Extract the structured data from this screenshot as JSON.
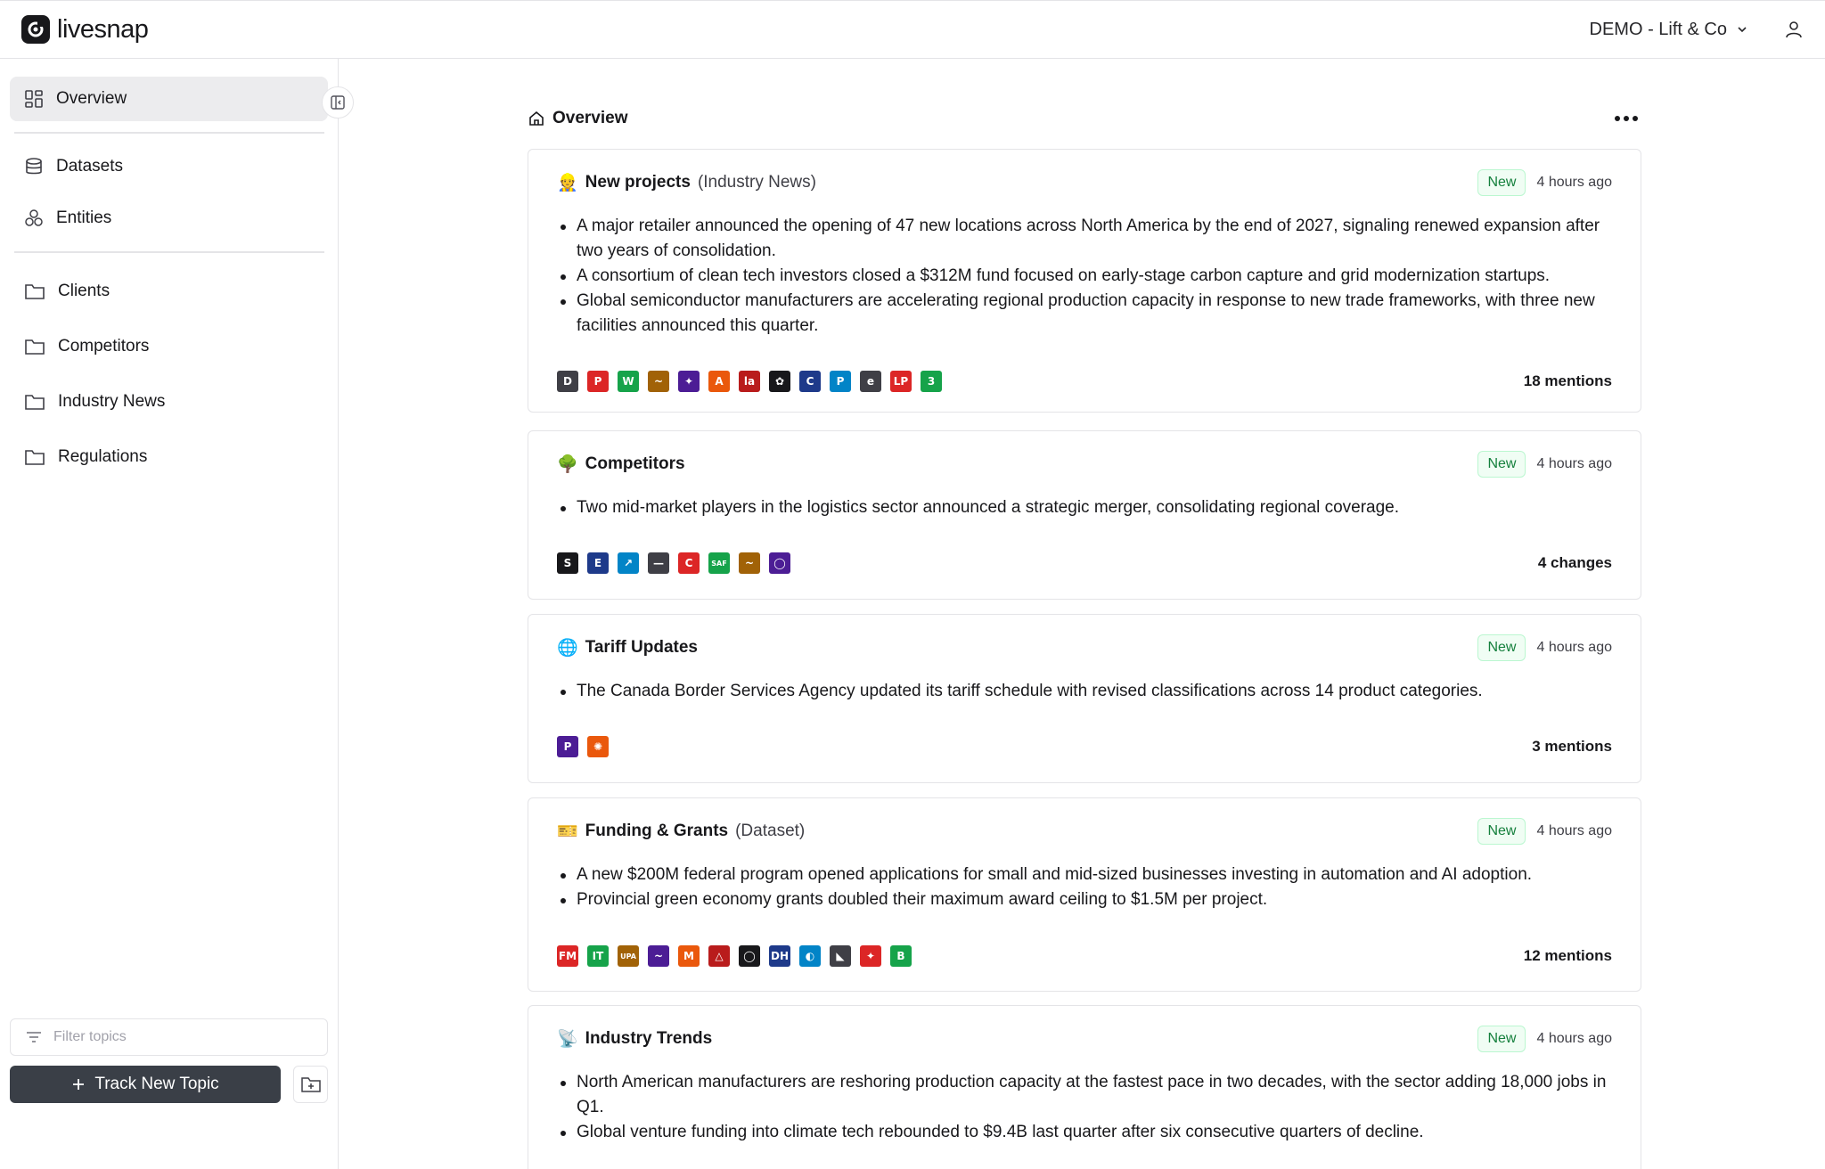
{
  "app": {
    "name": "livesnap",
    "org": "DEMO - Lift & Co"
  },
  "sidebar": {
    "items": [
      {
        "label": "Overview",
        "icon": "layout-dashboard-icon"
      },
      {
        "label": "Datasets",
        "icon": "database-icon"
      },
      {
        "label": "Entities",
        "icon": "boxes-icon"
      }
    ],
    "folders": [
      {
        "label": "Clients"
      },
      {
        "label": "Competitors"
      },
      {
        "label": "Industry News"
      },
      {
        "label": "Regulations"
      }
    ],
    "filter_placeholder": "Filter topics",
    "track_label": "Track New Topic"
  },
  "main": {
    "title": "Overview",
    "cards": [
      {
        "emoji": "👷",
        "title": "New projects",
        "subtitle": "(Industry News)",
        "badge": "New",
        "time": "4 hours ago",
        "bullets": [
          "A major retailer announced the opening of 47 new locations across North America by the end of 2027, signaling renewed expansion after two years of consolidation.",
          "A consortium of clean tech investors closed a $312M fund focused on early-stage carbon capture and grid modernization startups.",
          "Global semiconductor manufacturers are accelerating regional production capacity in response to new trade frameworks, with three new facilities announced this quarter."
        ],
        "count": "18 mentions",
        "sources": [
          "D",
          "P",
          "W",
          "~",
          "✦",
          "A",
          "la",
          "✿",
          "C",
          "P",
          "e",
          "LP",
          "3"
        ]
      },
      {
        "emoji": "🌳",
        "title": "Competitors",
        "subtitle": "",
        "badge": "New",
        "time": "4 hours ago",
        "bullets": [
          "Two mid-market players in the logistics sector announced a strategic merger, consolidating regional coverage."
        ],
        "count": "4 changes",
        "sources": [
          "S",
          "E",
          "↗",
          "—",
          "C",
          "SAF",
          "~",
          "◯"
        ]
      },
      {
        "emoji": "🌐",
        "title": "Tariff Updates",
        "subtitle": "",
        "badge": "New",
        "time": "4 hours ago",
        "bullets": [
          "The Canada Border Services Agency updated its tariff schedule with revised classifications across 14 product categories."
        ],
        "count": "3 mentions",
        "sources": [
          "P",
          "✺"
        ]
      },
      {
        "emoji": "🎫",
        "title": "Funding & Grants",
        "subtitle": "(Dataset)",
        "badge": "New",
        "time": "4 hours ago",
        "bullets": [
          "A new $200M federal program opened applications for small and mid-sized businesses investing in automation and AI adoption.",
          "Provincial green economy grants doubled their maximum award ceiling to $1.5M per project."
        ],
        "count": "12 mentions",
        "sources": [
          "FM",
          "IT",
          "UPA",
          "~",
          "M",
          "△",
          "◯",
          "DH",
          "◐",
          "◣",
          "✦",
          "B"
        ]
      },
      {
        "emoji": "📡",
        "title": "Industry Trends",
        "subtitle": "",
        "badge": "New",
        "time": "4 hours ago",
        "bullets": [
          "North American manufacturers are reshoring production capacity at the fastest pace in two decades, with the sector adding 18,000 jobs in Q1.",
          "Global venture funding into climate tech rebounded to $9.4B last quarter after six consecutive quarters of decline."
        ],
        "count": "",
        "sources": []
      }
    ]
  },
  "colors": {
    "accent_dark": "#3a3f47",
    "active_nav": "#ececee",
    "badge_green": "#15803d",
    "border": "#e4e4e7"
  }
}
